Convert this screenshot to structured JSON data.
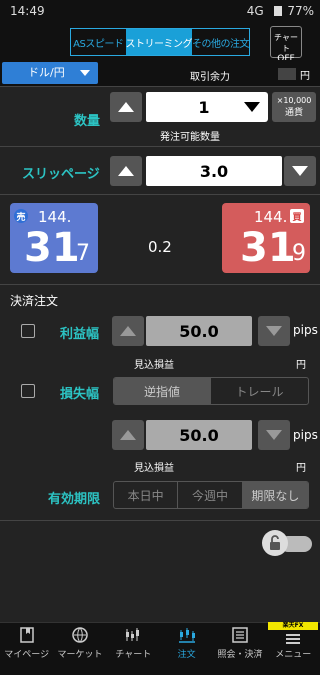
{
  "status_bar": {
    "time": "14:49",
    "network": "4G",
    "battery": "77%"
  },
  "header": {
    "tabs": [
      {
        "label": "ASスピード",
        "active": false
      },
      {
        "label": "ストリーミング",
        "active": true
      },
      {
        "label": "その他の注文",
        "active": false
      }
    ],
    "chart_toggle": {
      "line1": "チャート",
      "line2": "OFF"
    }
  },
  "currency_pair": {
    "label": "ドル/円"
  },
  "margin": {
    "label": "取引余力",
    "unit": "円"
  },
  "quantity": {
    "label": "数量",
    "value": "1",
    "multiplier_line1": "×10,000",
    "multiplier_line2": "通貨",
    "available_label": "発注可能数量"
  },
  "slippage": {
    "label": "スリッページ",
    "value": "3.0"
  },
  "prices": {
    "sell": {
      "tag": "売",
      "prefix": "144.",
      "big": "31",
      "small": "7"
    },
    "spread": "0.2",
    "buy": {
      "tag": "買",
      "prefix": "144.",
      "big": "31",
      "small": "9"
    }
  },
  "settlement": {
    "title": "決済注文",
    "take_profit": {
      "label": "利益幅",
      "value": "50.0",
      "unit": "pips",
      "estimate_label": "見込損益",
      "estimate_unit": "円"
    },
    "stop_loss": {
      "label": "損失幅",
      "modes": [
        "逆指値",
        "トレール"
      ],
      "value": "50.0",
      "unit": "pips",
      "estimate_label": "見込損益",
      "estimate_unit": "円"
    },
    "expiry": {
      "label": "有効期限",
      "options": [
        "本日中",
        "今週中",
        "期限なし"
      ],
      "selected": "期限なし"
    }
  },
  "bottom_nav": {
    "items": [
      {
        "label": "マイページ",
        "icon": "mypage-icon"
      },
      {
        "label": "マーケット",
        "icon": "market-icon"
      },
      {
        "label": "チャート",
        "icon": "chart-icon"
      },
      {
        "label": "注文",
        "icon": "order-icon",
        "active": true
      },
      {
        "label": "照会・決済",
        "icon": "inquiry-icon"
      },
      {
        "label": "メニュー",
        "icon": "menu-icon",
        "badge": "楽天FX"
      }
    ]
  },
  "colors": {
    "accent": "#2aa9e0",
    "label": "#2cc3c3",
    "sell": "#5d7ad1",
    "buy": "#d45c5c"
  }
}
